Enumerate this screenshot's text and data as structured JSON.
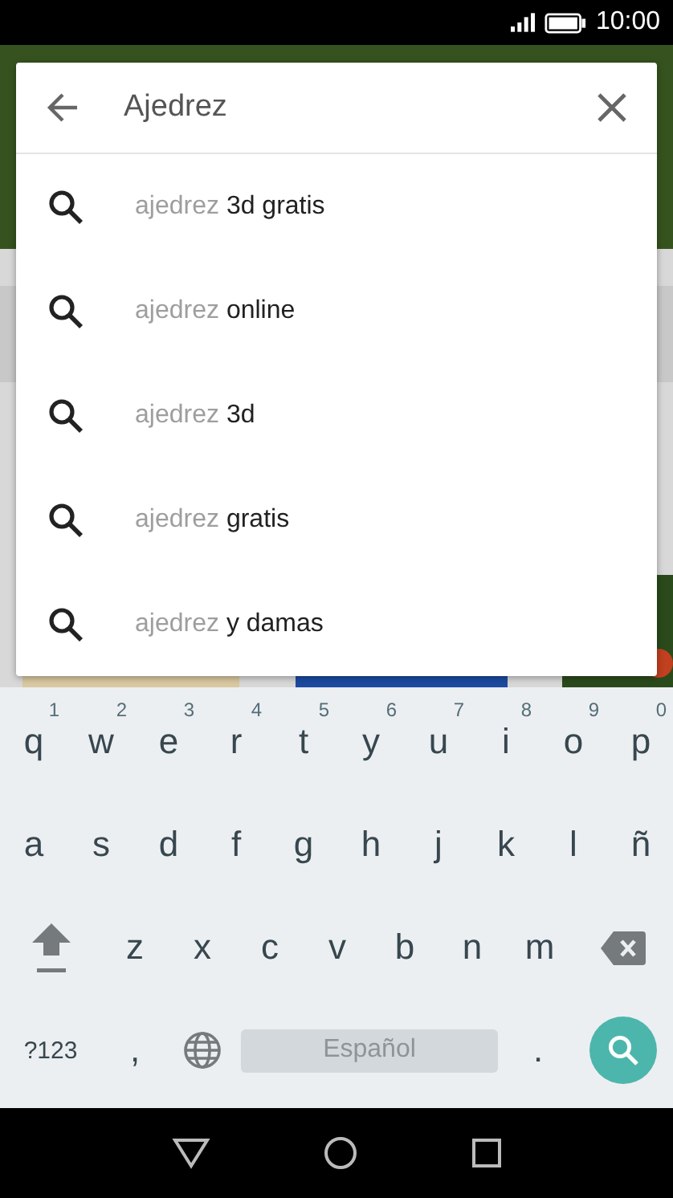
{
  "status_bar": {
    "time": "10:00"
  },
  "search": {
    "value": "Ajedrez"
  },
  "suggestions": [
    {
      "prefix": "ajedrez",
      "rest": "3d gratis"
    },
    {
      "prefix": "ajedrez",
      "rest": "online"
    },
    {
      "prefix": "ajedrez",
      "rest": "3d"
    },
    {
      "prefix": "ajedrez",
      "rest": "gratis"
    },
    {
      "prefix": "ajedrez",
      "rest": "y damas"
    }
  ],
  "keyboard": {
    "rows": [
      {
        "keys": [
          {
            "kind": "letter",
            "label": "q",
            "hint": "1"
          },
          {
            "kind": "letter",
            "label": "w",
            "hint": "2"
          },
          {
            "kind": "letter",
            "label": "e",
            "hint": "3"
          },
          {
            "kind": "letter",
            "label": "r",
            "hint": "4"
          },
          {
            "kind": "letter",
            "label": "t",
            "hint": "5"
          },
          {
            "kind": "letter",
            "label": "y",
            "hint": "6"
          },
          {
            "kind": "letter",
            "label": "u",
            "hint": "7"
          },
          {
            "kind": "letter",
            "label": "i",
            "hint": "8"
          },
          {
            "kind": "letter",
            "label": "o",
            "hint": "9"
          },
          {
            "kind": "letter",
            "label": "p",
            "hint": "0"
          }
        ]
      },
      {
        "keys": [
          {
            "kind": "letter",
            "label": "a"
          },
          {
            "kind": "letter",
            "label": "s"
          },
          {
            "kind": "letter",
            "label": "d"
          },
          {
            "kind": "letter",
            "label": "f"
          },
          {
            "kind": "letter",
            "label": "g"
          },
          {
            "kind": "letter",
            "label": "h"
          },
          {
            "kind": "letter",
            "label": "j"
          },
          {
            "kind": "letter",
            "label": "k"
          },
          {
            "kind": "letter",
            "label": "l"
          },
          {
            "kind": "letter",
            "label": "ñ"
          }
        ]
      },
      {
        "keys": [
          {
            "kind": "shift"
          },
          {
            "kind": "letter",
            "label": "z"
          },
          {
            "kind": "letter",
            "label": "x"
          },
          {
            "kind": "letter",
            "label": "c"
          },
          {
            "kind": "letter",
            "label": "v"
          },
          {
            "kind": "letter",
            "label": "b"
          },
          {
            "kind": "letter",
            "label": "n"
          },
          {
            "kind": "letter",
            "label": "m"
          },
          {
            "kind": "backspace"
          }
        ]
      },
      {
        "keys": [
          {
            "kind": "symbols",
            "label": "?123"
          },
          {
            "kind": "letter",
            "label": ","
          },
          {
            "kind": "globe"
          },
          {
            "kind": "space",
            "label": "Español"
          },
          {
            "kind": "letter",
            "label": "."
          },
          {
            "kind": "search"
          }
        ]
      }
    ]
  }
}
